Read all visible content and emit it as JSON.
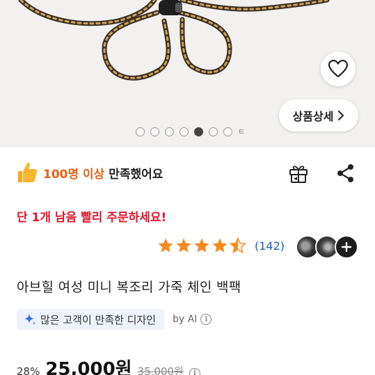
{
  "product_image": {
    "carousel": {
      "total": 8,
      "active_index": 4,
      "overflow_indicator": "ㅌ"
    },
    "wishlist": {
      "icon": "heart-icon"
    },
    "detail_button": {
      "label": "상품상세",
      "icon": "chevron-right-icon"
    }
  },
  "satisfaction": {
    "icon": "thumbs-up-icon",
    "highlight": "100명 이상",
    "suffix": "만족했어요"
  },
  "actions": {
    "gift_icon": "gift-icon",
    "share_icon": "share-icon"
  },
  "urgency": {
    "text": "단 1개 남음 빨리 주문하세요!"
  },
  "rating": {
    "stars": 4.5,
    "max_stars": 5,
    "count": "(142)"
  },
  "review_avatars": {
    "more_icon": "plus-icon"
  },
  "product": {
    "title": "아브힐 여성 미니 복조리 가죽 체인 백팩"
  },
  "ai_summary": {
    "icon": "sparkle-icon",
    "text": "많은 고객이 만족한 디자인",
    "by": "by AI"
  },
  "price": {
    "discount": "28%",
    "current": "25,000원",
    "original": "35,000원"
  },
  "colors": {
    "highlight": "#e8611a",
    "urgent": "#e0162b",
    "star": "#f58a1f",
    "link": "#1a5dbf"
  }
}
